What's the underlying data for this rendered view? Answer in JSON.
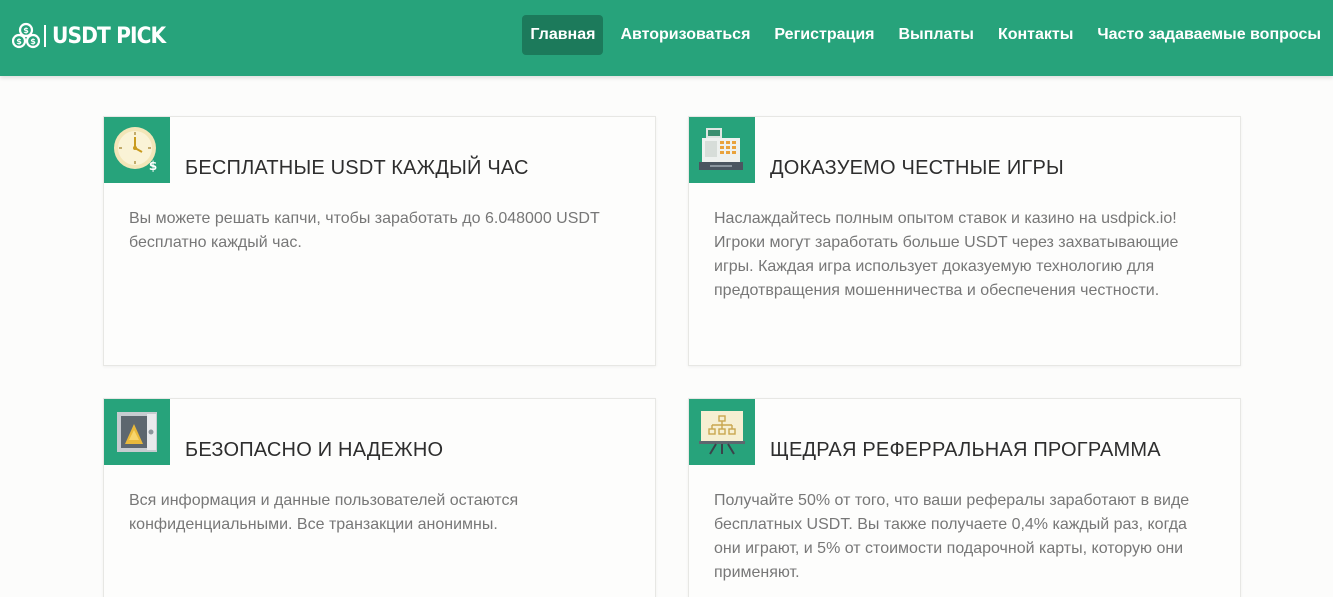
{
  "brand": {
    "name": "USDT PICK"
  },
  "nav": {
    "items": [
      {
        "label": "Главная",
        "active": true
      },
      {
        "label": "Авторизоваться"
      },
      {
        "label": "Регистрация"
      },
      {
        "label": "Выплаты"
      },
      {
        "label": "Контакты"
      },
      {
        "label": "Часто задаваемые вопросы"
      }
    ]
  },
  "features": [
    {
      "icon": "clock-icon",
      "title": "БЕСПЛАТНЫЕ USDT КАЖДЫЙ ЧАС",
      "text": "Вы можете решать капчи, чтобы заработать до 6.048000 USDT бесплатно каждый час."
    },
    {
      "icon": "cash-register-icon",
      "title": "ДОКАЗУЕМО ЧЕСТНЫЕ ИГРЫ",
      "text": "Наслаждайтесь полным опытом ставок и казино на usdpick.io! Игроки могут заработать больше USDT через захватывающие игры. Каждая игра использует доказуемую технологию для предотвращения мошенничества и обеспечения честности."
    },
    {
      "icon": "safe-icon",
      "title": "БЕЗОПАСНО И НАДЕЖНО",
      "text": "Вся информация и данные пользователей остаются конфиденциальными. Все транзакции анонимны."
    },
    {
      "icon": "presentation-board-icon",
      "title": "ЩЕДРАЯ РЕФЕРРАЛЬНАЯ ПРОГРАММА",
      "text": "Получайте 50% от того, что ваши рефералы заработают в виде бесплатных USDT. Вы также получаете 0,4% каждый раз, когда они играют, и 5% от стоимости подарочной карты, которую они применяют."
    }
  ],
  "colors": {
    "brand": "#27a37b",
    "active_nav": "#1c7a5b"
  }
}
